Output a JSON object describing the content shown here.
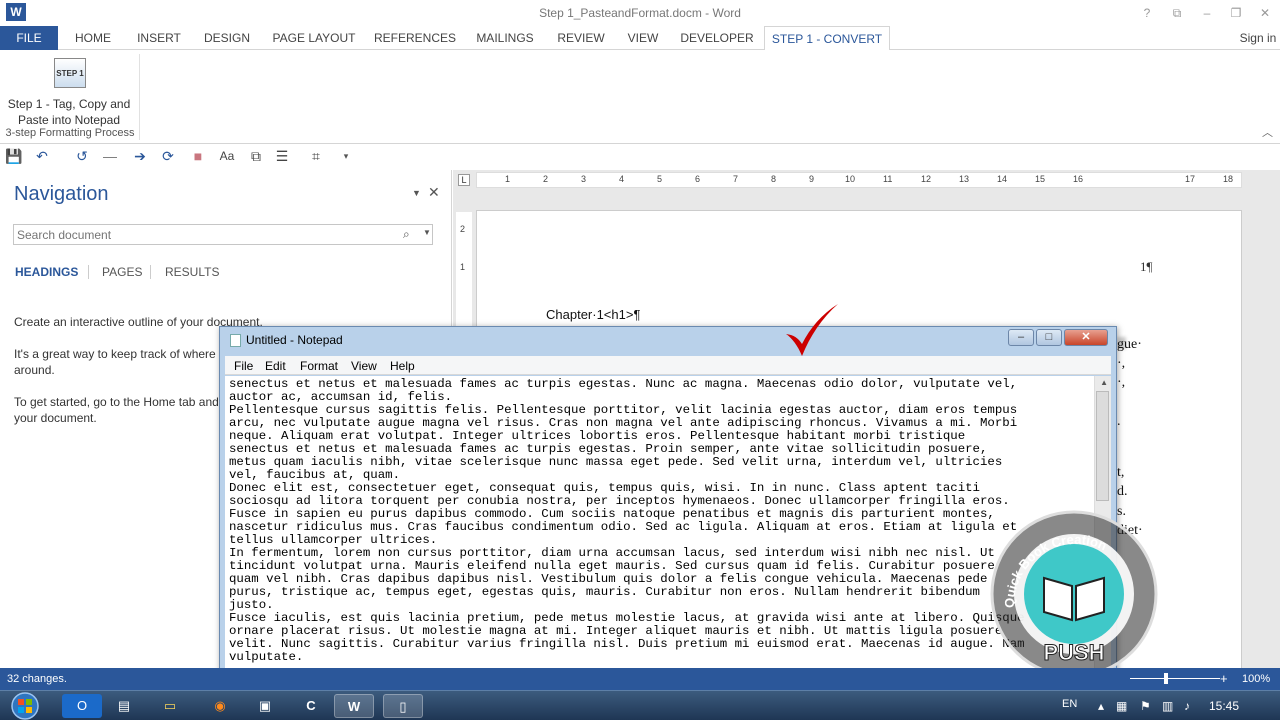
{
  "window": {
    "title": "Step 1_PasteandFormat.docm - Word",
    "logo": "W",
    "controls": [
      "?",
      "⧉",
      "–",
      "❐",
      "✕"
    ],
    "sign_in": "Sign in"
  },
  "tabs": [
    "FILE",
    "HOME",
    "INSERT",
    "DESIGN",
    "PAGE LAYOUT",
    "REFERENCES",
    "MAILINGS",
    "REVIEW",
    "VIEW",
    "DEVELOPER",
    "STEP 1 - CONVERT"
  ],
  "ribbon": {
    "step_icon_text": "STEP 1",
    "step_button_label": "Step 1 - Tag, Copy and Paste into Notepad",
    "group_label": "3-step Formatting Process"
  },
  "qat": {
    "icons": [
      "save-icon",
      "undo-icon",
      "repeat-icon",
      "line-icon",
      "forward-icon",
      "refresh-icon",
      "stop-icon",
      "font-case-icon",
      "copy-icon",
      "bullets-icon",
      "tree-icon",
      "customize-icon"
    ],
    "glyphs": [
      "💾",
      "↶",
      "↺",
      "—",
      "➔",
      "⟳",
      "■",
      "Aa",
      "⧉",
      "☰",
      "⌗",
      "▾"
    ]
  },
  "navigation": {
    "title": "Navigation",
    "search_placeholder": "Search document",
    "tabs": [
      "HEADINGS",
      "PAGES",
      "RESULTS"
    ],
    "paragraphs": [
      "Create an interactive outline of your document.",
      "It's a great way to keep track of where y",
      "around.",
      "To get started, go to the Home tab and",
      "your document."
    ]
  },
  "ruler": {
    "corner": "L",
    "ticks": [
      "1",
      "2",
      "3",
      "4",
      "5",
      "6",
      "7",
      "8",
      "9",
      "10",
      "11",
      "12",
      "13",
      "14",
      "15",
      "16",
      "17",
      "18"
    ],
    "left_ticks": [
      "2",
      "1"
    ]
  },
  "document": {
    "page_number": "1¶",
    "chapter_line": "Chapter·1<h1>¶",
    "right_fragments": [
      "gue·",
      "·,",
      "·,",
      ".",
      "t,",
      "d.",
      "s.",
      "diet·"
    ]
  },
  "notepad": {
    "title": "Untitled - Notepad",
    "menu": [
      "File",
      "Edit",
      "Format",
      "View",
      "Help"
    ],
    "lines": [
      "senectus et netus et malesuada fames ac turpis egestas. Nunc ac magna. Maecenas odio dolor, vulputate vel,",
      "auctor ac, accumsan id, felis.",
      "Pellentesque cursus sagittis felis. Pellentesque porttitor, velit lacinia egestas auctor, diam eros tempus",
      "arcu, nec vulputate augue magna vel risus. Cras non magna vel ante adipiscing rhoncus. Vivamus a mi. Morbi",
      "neque. Aliquam erat volutpat. Integer ultrices lobortis eros. Pellentesque habitant morbi tristique",
      "senectus et netus et malesuada fames ac turpis egestas. Proin semper, ante vitae sollicitudin posuere,",
      "metus quam iaculis nibh, vitae scelerisque nunc massa eget pede. Sed velit urna, interdum vel, ultricies",
      "vel, faucibus at, quam.",
      "Donec elit est, consectetuer eget, consequat quis, tempus quis, wisi. In in nunc. Class aptent taciti",
      "sociosqu ad litora torquent per conubia nostra, per inceptos hymenaeos. Donec ullamcorper fringilla eros.",
      "Fusce in sapien eu purus dapibus commodo. Cum sociis natoque penatibus et magnis dis parturient montes,",
      "nascetur ridiculus mus. Cras faucibus condimentum odio. Sed ac ligula. Aliquam at eros. Etiam at ligula et",
      "tellus ullamcorper ultrices.",
      "In fermentum, lorem non cursus porttitor, diam urna accumsan lacus, sed interdum wisi nibh nec nisl. Ut",
      "tincidunt volutpat urna. Mauris eleifend nulla eget mauris. Sed cursus quam id felis. Curabitur posuere",
      "quam vel nibh. Cras dapibus dapibus nisl. Vestibulum quis dolor a felis congue vehicula. Maecenas pede",
      "purus, tristique ac, tempus eget, egestas quis, mauris. Curabitur non eros. Nullam hendrerit bibendum",
      "justo.",
      "Fusce iaculis, est quis lacinia pretium, pede metus molestie lacus, at gravida wisi ante at libero. Quisque",
      "ornare placerat risus. Ut molestie magna at mi. Integer aliquet mauris et nibh. Ut mattis ligula posuere",
      "velit. Nunc sagittis. Curabitur varius fringilla nisl. Duis pretium mi euismod erat. Maecenas id augue. Nam",
      "vulputate."
    ]
  },
  "badge": {
    "arc_text": "Quick Book Creation",
    "label": "PUSH"
  },
  "status": {
    "changes": "32 changes.",
    "zoom": "100%",
    "zoom_level": 1.0
  },
  "taskbar": {
    "apps": [
      "outlook-icon",
      "store-icon",
      "explorer-icon",
      "firefox-icon",
      "remote-icon",
      "camtasia-icon",
      "word-icon",
      "notepad-icon"
    ],
    "glyphs": [
      "O",
      "▤",
      "▭",
      "◉",
      "▣",
      "C",
      "W",
      "▯"
    ],
    "language": "EN",
    "clock": "15:45"
  },
  "colors": {
    "accent": "#2b579a",
    "check": "#cc0000",
    "badge_teal": "#3fc8c8"
  }
}
